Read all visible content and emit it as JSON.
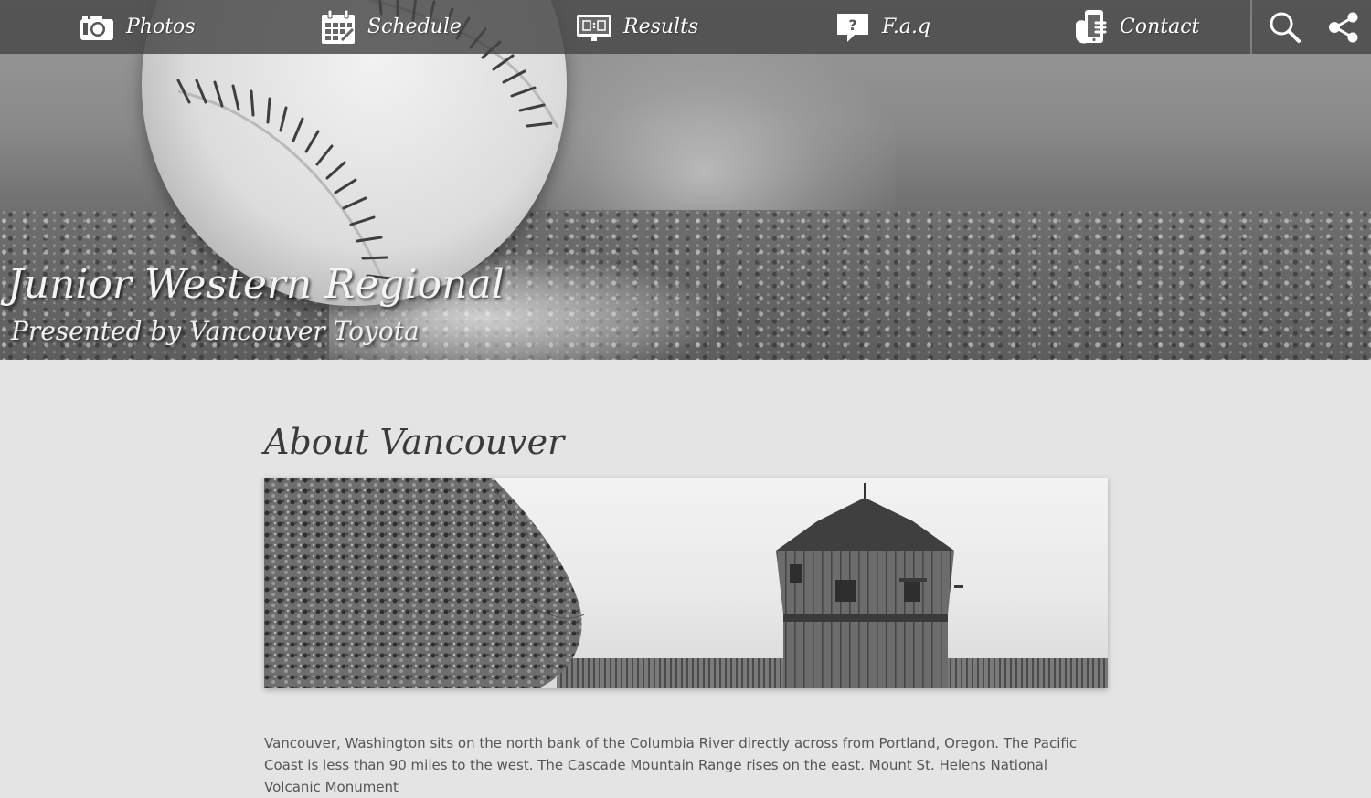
{
  "nav": {
    "items": [
      {
        "label": "Photos",
        "icon": "camera-icon"
      },
      {
        "label": "Schedule",
        "icon": "calendar-icon"
      },
      {
        "label": "Results",
        "icon": "scoreboard-icon"
      },
      {
        "label": "F.a.q",
        "icon": "question-bubble-icon"
      },
      {
        "label": "Contact",
        "icon": "phone-hand-icon"
      }
    ],
    "tools": [
      {
        "icon": "search-icon"
      },
      {
        "icon": "share-icon"
      }
    ]
  },
  "hero": {
    "title": "Junior Western Regional",
    "subtitle": "Presented by Vancouver Toyota"
  },
  "main": {
    "section_title": "About Vancouver",
    "body_text": "Vancouver, Washington sits on the north bank of the Columbia River directly across from Portland, Oregon. The Pacific Coast is less than 90 miles to the west. The Cascade Mountain Range rises on the east. Mount St. Helens National Volcanic Monument"
  },
  "colors": {
    "nav_bg": "#464646",
    "page_bg": "#e4e4e4",
    "title_text": "#3a3a3a",
    "body_text": "#555555"
  }
}
